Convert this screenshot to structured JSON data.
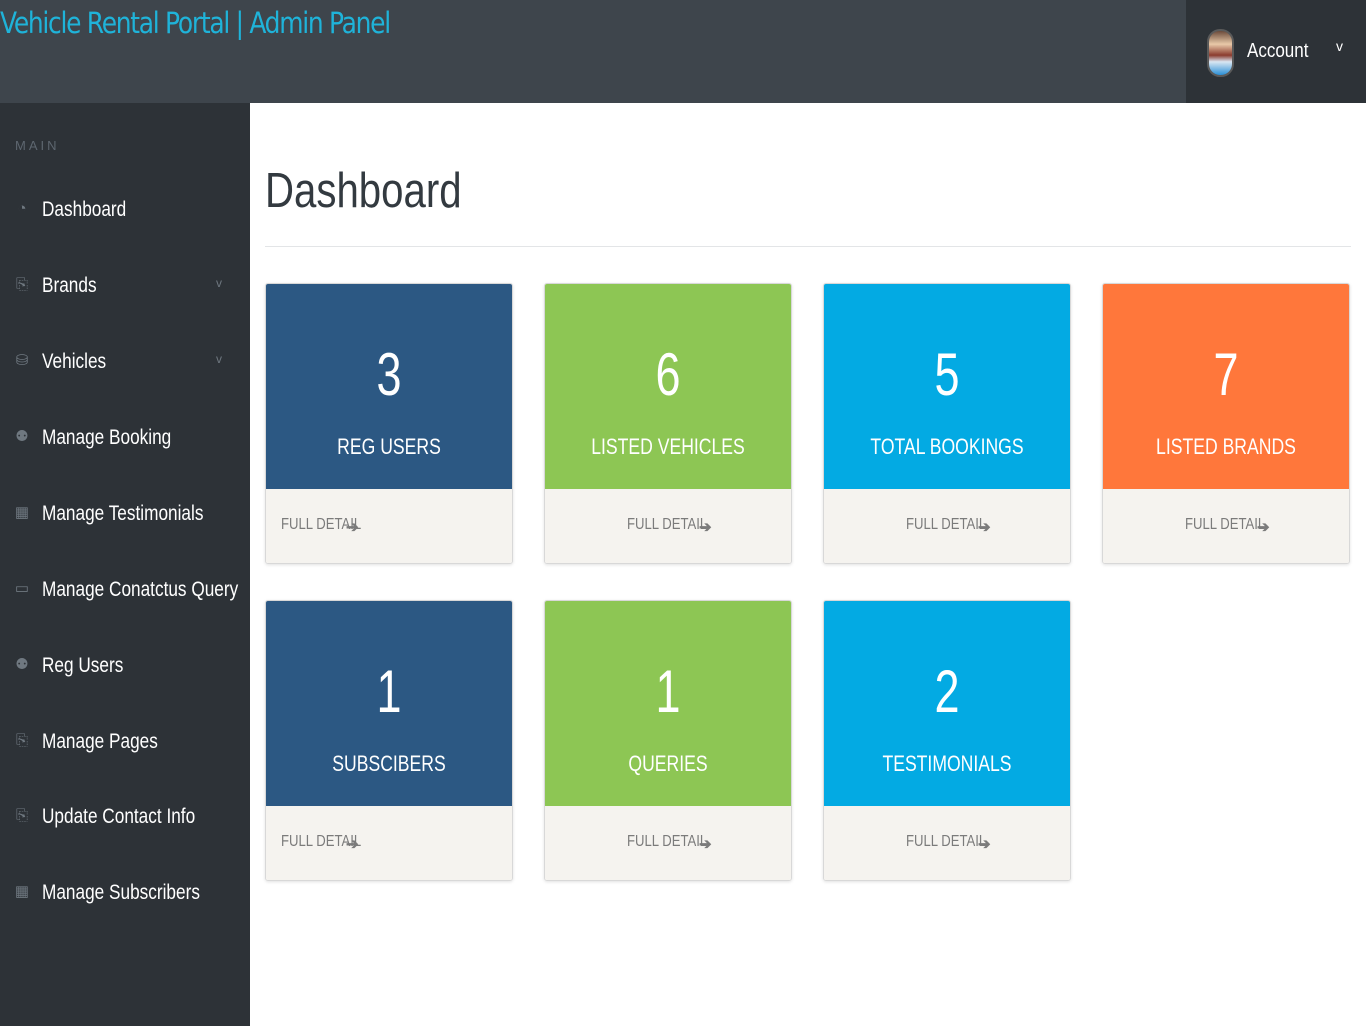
{
  "header": {
    "title": "Vehicle Rental Portal | Admin Panel",
    "account_label": "Account",
    "account_caret": "v"
  },
  "sidebar": {
    "heading": "MAIN",
    "items": [
      {
        "label": "Dashboard",
        "icon": "dashboard-icon",
        "glyph": "◔"
      },
      {
        "label": "Brands",
        "icon": "files-icon",
        "glyph": "⎘",
        "caret": "v"
      },
      {
        "label": "Vehicles",
        "icon": "sitemap-icon",
        "glyph": "⛁",
        "caret": "v"
      },
      {
        "label": "Manage Booking",
        "icon": "users-icon",
        "glyph": "⚉"
      },
      {
        "label": "Manage Testimonials",
        "icon": "table-icon",
        "glyph": "▦"
      },
      {
        "label": "Manage Conatctus Query",
        "icon": "desktop-icon",
        "glyph": "▭"
      },
      {
        "label": "Reg Users",
        "icon": "users-icon",
        "glyph": "⚉"
      },
      {
        "label": "Manage Pages",
        "icon": "files-icon",
        "glyph": "⎘"
      },
      {
        "label": "Update Contact Info",
        "icon": "files-icon",
        "glyph": "⎘"
      },
      {
        "label": "Manage Subscribers",
        "icon": "table-icon",
        "glyph": "▦"
      }
    ]
  },
  "main": {
    "title": "Dashboard",
    "cards": [
      {
        "count": "3",
        "label": "REG USERS",
        "color": "#2c5883",
        "link": "FULL DETAIL"
      },
      {
        "count": "6",
        "label": "LISTED VEHICLES",
        "color": "#8dc654",
        "link": "FULL DETAIL"
      },
      {
        "count": "5",
        "label": "TOTAL BOOKINGS",
        "color": "#03aae3",
        "link": "FULL DETAIL"
      },
      {
        "count": "7",
        "label": "LISTED BRANDS",
        "color": "#ff773b",
        "link": "FULL DETAIL"
      },
      {
        "count": "1",
        "label": "SUBSCIBERS",
        "color": "#2c5883",
        "link": "FULL DETAIL"
      },
      {
        "count": "1",
        "label": "QUERIES",
        "color": "#8dc654",
        "link": "FULL DETAIL"
      },
      {
        "count": "2",
        "label": "TESTIMONIALS",
        "color": "#03aae3",
        "link": "FULL DETAIL"
      }
    ],
    "arrow_glyph": "➔"
  }
}
